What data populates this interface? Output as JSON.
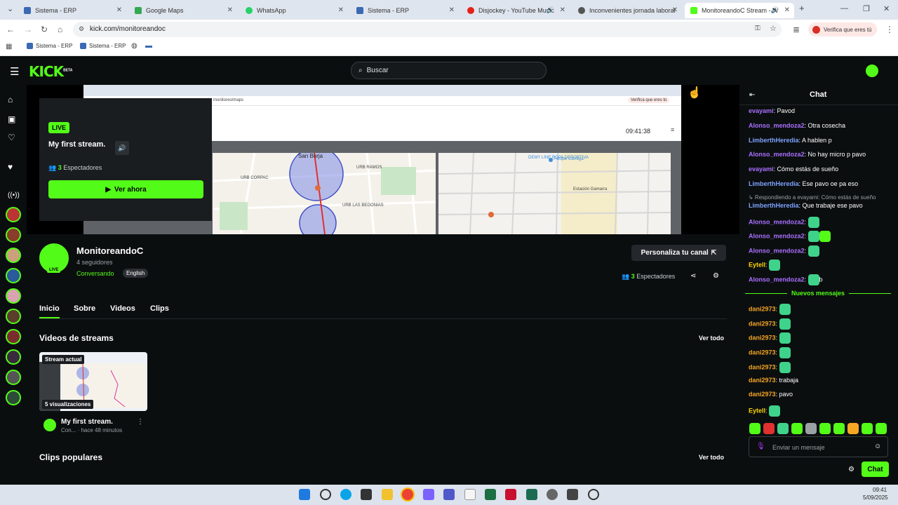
{
  "browser": {
    "tabs": [
      {
        "title": "Sistema - ERP",
        "color": "#3a6ab5"
      },
      {
        "title": "Google Maps",
        "color": "#34a853"
      },
      {
        "title": "WhatsApp",
        "color": "#25d366"
      },
      {
        "title": "Sistema - ERP",
        "color": "#3a6ab5"
      },
      {
        "title": "Disjockey - YouTube Music",
        "color": "#e62117"
      },
      {
        "title": "Inconvenientes jornada laboral",
        "color": "#555555"
      },
      {
        "title": "MonitoreandoC Stream - W",
        "color": "#53fc18"
      }
    ],
    "url": "kick.com/monitoreandoc",
    "profile_label": "Verifica que eres tú",
    "bookmarks": [
      "Sistema - ERP",
      "Sistema - ERP"
    ]
  },
  "kick": {
    "logo": "KICK",
    "beta": "BETA",
    "search_placeholder": "Buscar",
    "accent": "#53fc18"
  },
  "stream": {
    "inner_time": "09:41:38",
    "inner_url": "monitoreo/maps",
    "inner_profile": "Verifica que eres tú",
    "map_labels": [
      "San Borja",
      "URB CORPAC",
      "URB LAS BEGONIAS",
      "URB RAMOS",
      "Estación Gamarra",
      "DEMY LINE ROPA DEPORTIVA",
      "Parque Carrega"
    ],
    "live_badge": "LIVE",
    "title": "My first stream.",
    "viewers_count": "3",
    "viewers_label": "Espectadores",
    "watch_button": "Ver ahora"
  },
  "channel": {
    "name": "MonitoreandoC",
    "followers": "4 seguidores",
    "category": "Conversando",
    "language": "English",
    "live_badge": "LIVE",
    "customize_button": "Personaliza tu canal",
    "viewers_count": "3",
    "viewers_label": "Espectadores",
    "tabs": [
      "Inicio",
      "Sobre",
      "Videos",
      "Clips"
    ]
  },
  "sections": {
    "videos_title": "Videos de streams",
    "see_all": "Ver todo",
    "clips_title": "Clips populares",
    "see_all_2": "Ver todo"
  },
  "video_card": {
    "badge": "Stream actual",
    "views": "5 visualizaciones",
    "title": "My first stream.",
    "category_short": "Con...",
    "time": "hace 48 minutos"
  },
  "chat": {
    "title": "Chat",
    "messages": [
      {
        "user": "evayami",
        "text": "Pavod",
        "color": "#a970ff"
      },
      {
        "user": "Alonso_mendoza2",
        "text": "Otra cosecha",
        "color": "#a970ff"
      },
      {
        "user": "LimberthHeredia",
        "text": "A hablen p",
        "color": "#7ea3ff"
      },
      {
        "user": "Alonso_mendoza2",
        "text": "No hay micro p pavo",
        "color": "#a970ff"
      },
      {
        "user": "evayami",
        "text": "Cómo estás de sueño",
        "color": "#a970ff"
      },
      {
        "user": "LimberthHeredia",
        "text": "Ese pavo oe pa eso",
        "color": "#7ea3ff"
      },
      {
        "reply": "Respondiendo a evayami: Cómo estás de sueño"
      },
      {
        "user": "LimberthHeredia",
        "text": "Que trabaje ese pavo",
        "color": "#7ea3ff"
      },
      {
        "user": "Alonso_mendoza2",
        "text": "",
        "color": "#a970ff",
        "emotes": 1
      },
      {
        "user": "Alonso_mendoza2",
        "text": "",
        "color": "#a970ff",
        "emotes": 2
      },
      {
        "user": "Alonso_mendoza2",
        "text": "",
        "color": "#a970ff",
        "emotes": 1
      },
      {
        "user": "Eytell",
        "text": "",
        "color": "#ffd400",
        "emotes": 1
      },
      {
        "user": "Alonso_mendoza2",
        "text": "b",
        "color": "#a970ff",
        "emotes": 1
      }
    ],
    "new_messages": "Nuevos mensajes",
    "messages2": [
      {
        "user": "dani2973",
        "text": "",
        "color": "#f5a623",
        "emotes": 1
      },
      {
        "user": "dani2973",
        "text": "",
        "color": "#f5a623",
        "emotes": 1
      },
      {
        "user": "dani2973",
        "text": "",
        "color": "#f5a623",
        "emotes": 1
      },
      {
        "user": "dani2973",
        "text": "",
        "color": "#f5a623",
        "emotes": 1
      },
      {
        "user": "dani2973",
        "text": "",
        "color": "#f5a623",
        "emotes": 1
      },
      {
        "user": "dani2973",
        "text": "trabaja",
        "color": "#f5a623"
      },
      {
        "user": "dani2973",
        "text": "pavo",
        "color": "#f5a623"
      },
      {
        "user": "Eytell",
        "text": "",
        "color": "#ffd400",
        "emotes": 1
      }
    ],
    "input_placeholder": "Enviar un mensaje",
    "send_button": "Chat"
  },
  "taskbar": {
    "time": "09:41",
    "date": "5/09/2025"
  }
}
